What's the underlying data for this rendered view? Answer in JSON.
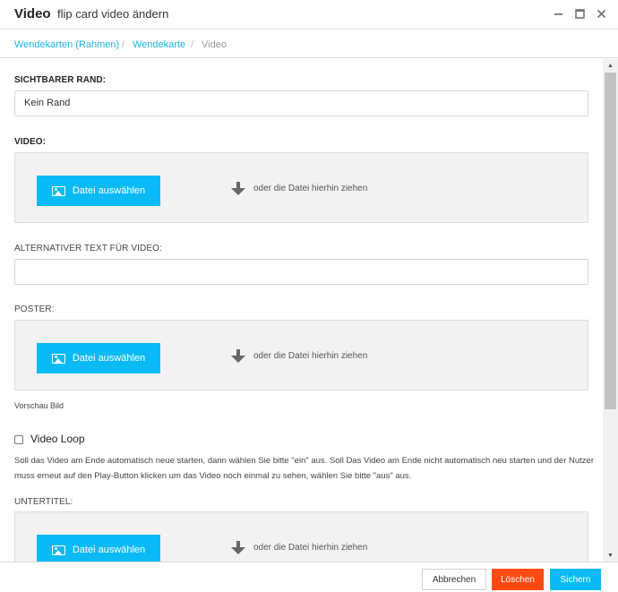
{
  "window": {
    "title": "Video",
    "subtitle": "flip card video ändern",
    "minimize_glyph": "▬",
    "maximize_glyph": "☐",
    "close_glyph": "✕"
  },
  "breadcrumb": {
    "items": [
      "Wendekarten (Rahmen)",
      "Wendekarte",
      "Video"
    ],
    "separator": "/"
  },
  "form": {
    "border_label": "SICHTBARER RAND:",
    "border_value": "Kein Rand",
    "video_label": "VIDEO:",
    "alt_label": "ALTERNATIVER TEXT FÜR VIDEO:",
    "alt_value": "",
    "poster_label": "POSTER:",
    "preview_note": "Vorschau Bild",
    "loop_label": "Video Loop",
    "loop_checked": false,
    "loop_help": "Soll das Video am Ende automatisch neue starten, dann wählen Sie bitte \"ein\" aus. Soll Das Video am Ende nicht automatisch neu starten und der Nutzer muss erneut auf den Play-Button klicken um das Video noch einmal zu sehen, wählen Sie bitte \"aus\" aus.",
    "subtitle_label": "UNTERTITEL:"
  },
  "dropzone": {
    "button_label": "Datei auswählen",
    "drop_text": "oder die Datei hierhin ziehen",
    "button_icon": "image-icon",
    "arrow_icon": "arrow-down-icon"
  },
  "footer": {
    "cancel": "Abbrechen",
    "delete": "Löschen",
    "save": "Sichern"
  },
  "colors": {
    "accent": "#0abaf5",
    "danger": "#ff4a12",
    "link": "#19b3e6"
  }
}
